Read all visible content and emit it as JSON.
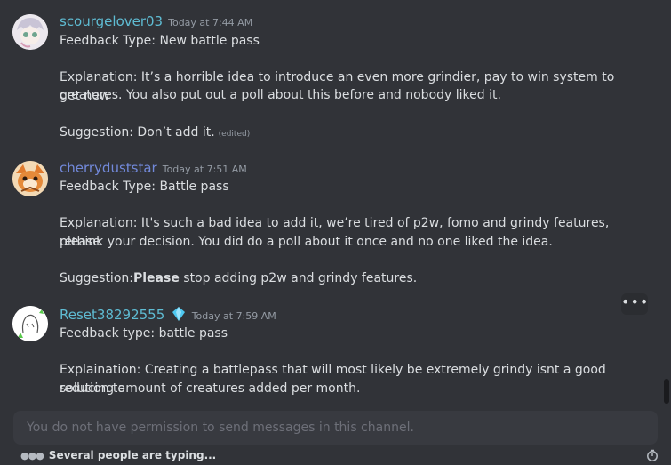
{
  "colors": {
    "background": "#313338",
    "name_teal": "#5fbcd3",
    "name_blue": "#7289da"
  },
  "messages": [
    {
      "username": "scourgelover03",
      "timestamp": "Today at 7:44 AM",
      "avatar_icon": "pale-hair-character-avatar",
      "lines": [
        "Feedback Type: New battle pass",
        "Explanation: It’s a horrible idea to introduce an even more grindier, pay to win system to get new",
        "creatures. You also put out a poll about this before and nobody liked it.",
        "Suggestion: Don’t add it."
      ],
      "edited": "(edited)"
    },
    {
      "username": "cherryduststar",
      "timestamp": "Today at 7:51 AM",
      "avatar_icon": "orange-creature-avatar",
      "lines": [
        "Feedback Type: Battle pass",
        "Explanation: It's such a bad idea to add it, we’re tired of p2w, fomo and grindy features, please",
        "rethink your decision. You did do a poll about it once and no one liked the idea."
      ],
      "suggestion_prefix": "Suggestion:",
      "suggestion_bold": "Please",
      "suggestion_rest": " stop adding p2w and grindy features."
    },
    {
      "username": "Reset38292555",
      "timestamp": "Today at 7:59 AM",
      "avatar_icon": "sketch-creature-avatar",
      "badge_icon": "diamond-badge-icon",
      "lines": [
        "Feedback type: battle pass",
        "Explaination: Creating a battlepass that will most likely be extremely grindy isnt a good solution to",
        "reducing amount of creatures added per month."
      ]
    }
  ],
  "hover_menu_icon": "more-options-icon",
  "composer": {
    "placeholder": "You do not have permission to send messages in this channel."
  },
  "typing": {
    "text": "Several people are typing..."
  },
  "timer_icon": "slowmode-timer-icon"
}
